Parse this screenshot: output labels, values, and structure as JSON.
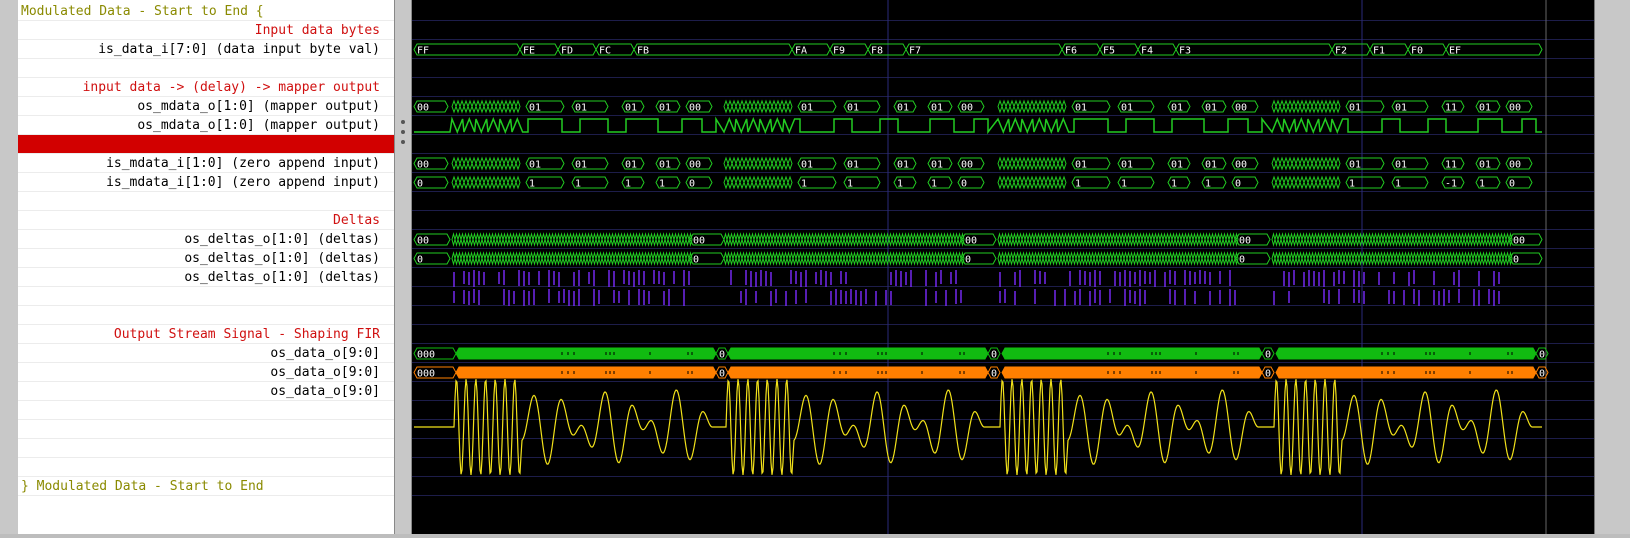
{
  "names": [
    {
      "text": "Modulated Data - Start to End {",
      "kind": "group"
    },
    {
      "text": "Input data bytes",
      "kind": "comment"
    },
    {
      "text": "is_data_i[7:0] (data input byte val)",
      "kind": "sig"
    },
    {
      "text": "",
      "kind": "blank"
    },
    {
      "text": "input data -> (delay) -> mapper output",
      "kind": "comment"
    },
    {
      "text": "os_mdata_o[1:0] (mapper output)",
      "kind": "sig"
    },
    {
      "text": "os_mdata_o[1:0] (mapper output)",
      "kind": "sig"
    },
    {
      "text": "",
      "kind": "selected"
    },
    {
      "text": "is_mdata_i[1:0] (zero append input)",
      "kind": "sig"
    },
    {
      "text": "is_mdata_i[1:0] (zero append input)",
      "kind": "sig"
    },
    {
      "text": "",
      "kind": "blank"
    },
    {
      "text": "Deltas",
      "kind": "comment"
    },
    {
      "text": "os_deltas_o[1:0] (deltas)",
      "kind": "sig"
    },
    {
      "text": "os_deltas_o[1:0] (deltas)",
      "kind": "sig"
    },
    {
      "text": "os_deltas_o[1:0] (deltas)",
      "kind": "sig"
    },
    {
      "text": "",
      "kind": "blank"
    },
    {
      "text": "",
      "kind": "blank"
    },
    {
      "text": "Output Stream Signal - Shaping FIR",
      "kind": "comment"
    },
    {
      "text": "os_data_o[9:0]",
      "kind": "sig"
    },
    {
      "text": "os_data_o[9:0]",
      "kind": "sig"
    },
    {
      "text": "os_data_o[9:0]",
      "kind": "sig"
    },
    {
      "text": "",
      "kind": "blank"
    },
    {
      "text": "",
      "kind": "blank"
    },
    {
      "text": "",
      "kind": "blank"
    },
    {
      "text": "",
      "kind": "blank"
    },
    {
      "text": "} Modulated Data - Start to End",
      "kind": "group"
    }
  ],
  "waves": {
    "bytes": [
      "FF",
      "FE",
      "FD",
      "FC",
      "FB",
      "FA",
      "F9",
      "F8",
      "F7",
      "F6",
      "F5",
      "F4",
      "F3",
      "F2",
      "F1",
      "F0",
      "EF"
    ],
    "mdata_labels": [
      "00",
      "01",
      "01",
      "01",
      "01",
      "00",
      "01",
      "01",
      "01",
      "01",
      "00",
      "01",
      "01",
      "01",
      "01",
      "00",
      "01",
      "01",
      "11",
      "01",
      "00"
    ],
    "is_mdata_labels2": [
      "0",
      "1",
      "1",
      "1",
      "1",
      "0",
      "1",
      "1",
      "1",
      "1",
      "0",
      "1",
      "1",
      "1",
      "1",
      "0",
      "1",
      "1",
      "-1",
      "1",
      "0"
    ],
    "deltas_labels": [
      "00",
      "00",
      "00",
      "00",
      "00"
    ],
    "deltas_labels2": [
      "0",
      "0",
      "0",
      "0",
      "0"
    ],
    "os_data_labels": [
      "000",
      "0",
      "0",
      "0",
      "0"
    ]
  },
  "colors": {
    "bus": "#22cc22",
    "bus_fill": "#11bb11",
    "orange": "#ff7f00",
    "purple": "#7a2cff",
    "yellow": "#f2e21a",
    "comment": "#d01010",
    "group": "#8a8a00",
    "selected_row": "#d20000"
  }
}
